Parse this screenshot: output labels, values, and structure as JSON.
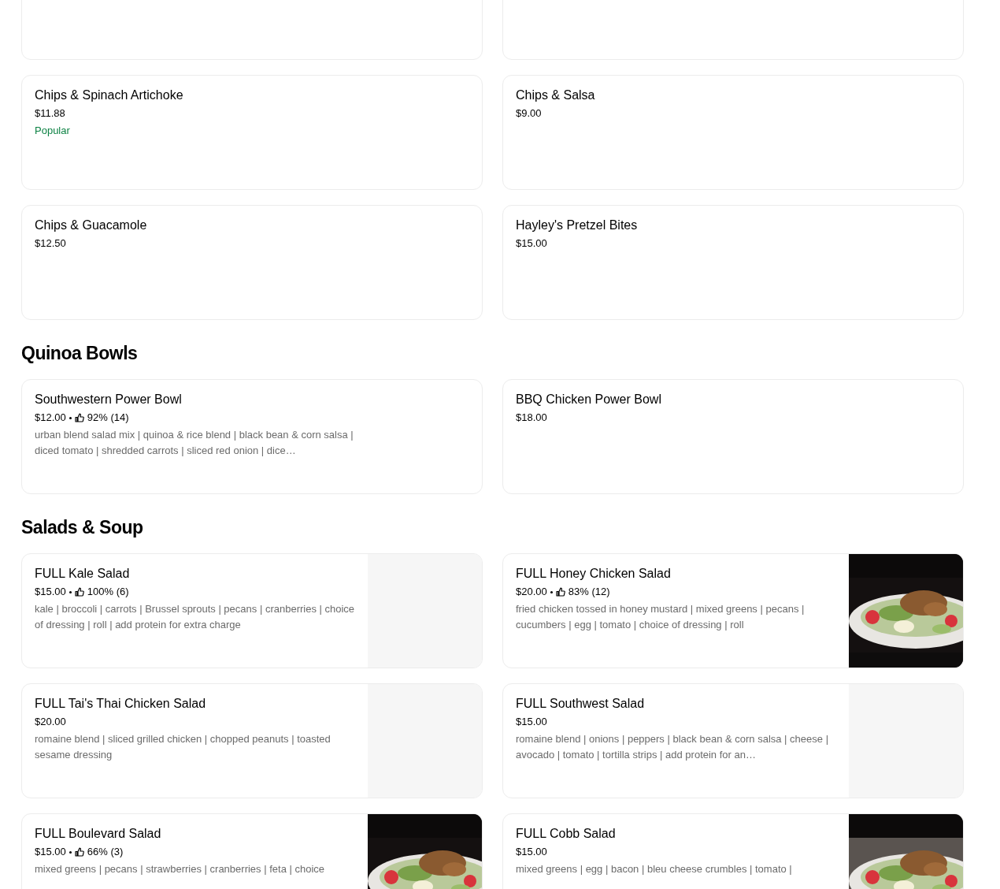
{
  "sections": [
    {
      "items": [
        {
          "name": "Chips & Spinach Artichoke",
          "price": "$11.88",
          "tag": "Popular"
        },
        {
          "name": "Chips & Salsa",
          "price": "$9.00"
        },
        {
          "name": "Chips & Guacamole",
          "price": "$12.50"
        },
        {
          "name": "Hayley's Pretzel Bites",
          "price": "$15.00"
        }
      ]
    },
    {
      "title": "Quinoa Bowls",
      "items": [
        {
          "name": "Southwestern Power Bowl",
          "price": "$12.00",
          "rating": "92% (14)",
          "description": "urban blend salad mix | quinoa & rice blend | black bean & corn salsa | diced tomato | shredded carrots | sliced red onion | dice…"
        },
        {
          "name": "BBQ Chicken Power Bowl",
          "price": "$18.00"
        }
      ]
    },
    {
      "title": "Salads & Soup",
      "items": [
        {
          "name": "FULL Kale Salad",
          "price": "$15.00",
          "rating": "100% (6)",
          "description": "kale | broccoli | carrots | Brussel sprouts | pecans | cranberries | choice of dressing | roll | add protein for extra charge",
          "kind": "placeholder"
        },
        {
          "name": "FULL Honey Chicken Salad",
          "price": "$20.00",
          "rating": "83% (12)",
          "description": "fried chicken tossed in honey mustard | mixed greens | pecans | cucumbers | egg | tomato | choice of dressing | roll",
          "kind": "picture"
        },
        {
          "name": "FULL Tai's Thai Chicken Salad",
          "price": "$20.00",
          "description": "romaine blend | sliced grilled chicken | chopped peanuts | toasted sesame dressing",
          "kind": "placeholder"
        },
        {
          "name": "FULL Southwest Salad",
          "price": "$15.00",
          "description": "romaine blend | onions | peppers | black bean & corn salsa | cheese | avocado | tomato | tortilla strips | add protein for an…",
          "kind": "placeholder"
        },
        {
          "name": "FULL Boulevard Salad",
          "price": "$15.00",
          "rating": "66% (3)",
          "description": "mixed greens | pecans | strawberries | cranberries | feta | choice",
          "kind": "picture"
        },
        {
          "name": "FULL Cobb Salad",
          "price": "$15.00",
          "description": "mixed greens | egg | bacon | bleu cheese crumbles | tomato |",
          "kind": "picture"
        }
      ]
    }
  ]
}
